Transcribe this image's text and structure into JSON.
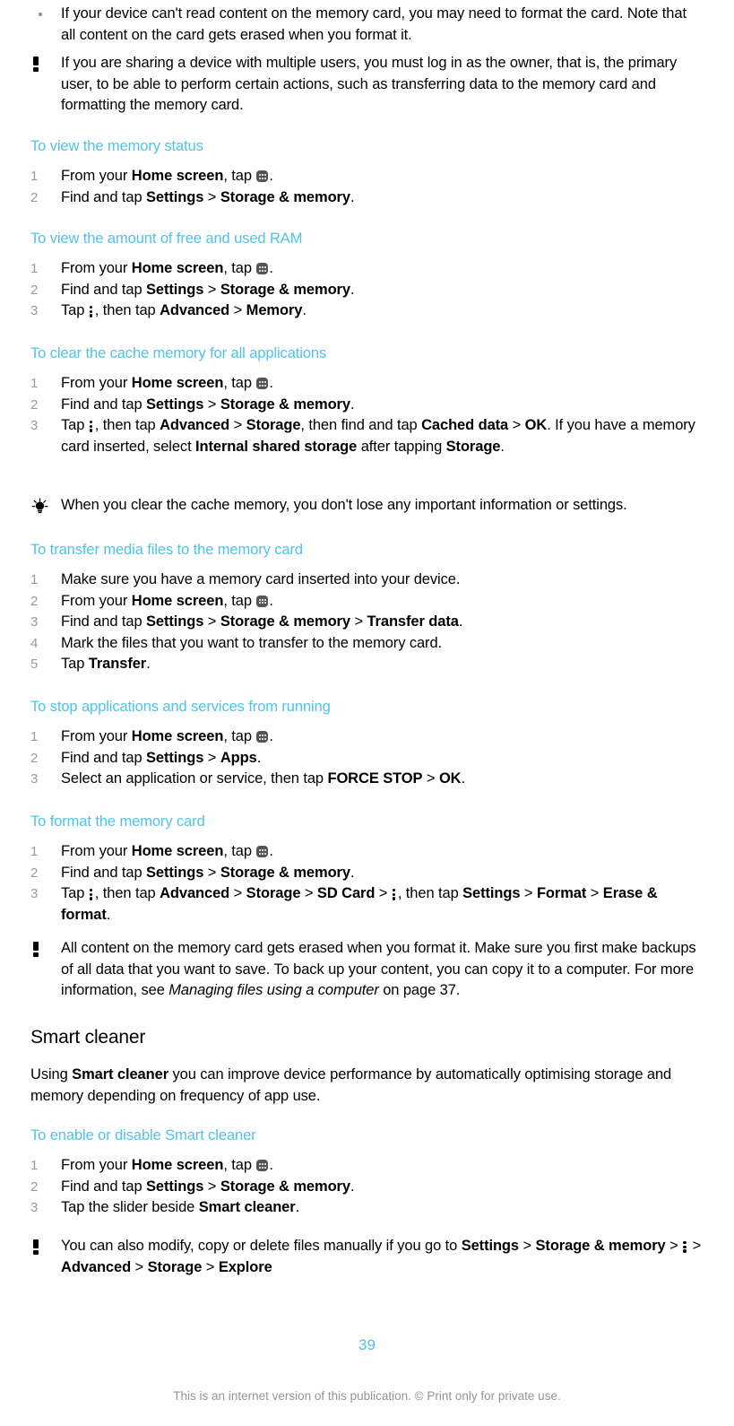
{
  "page": {
    "number": "39",
    "footer": "This is an internet version of this publication. © Print only for private use."
  },
  "icons": {
    "app_drawer": "app-drawer-icon",
    "overflow": "overflow-menu-icon",
    "note": "exclamation-note-icon",
    "tip": "lightbulb-tip-icon",
    "bullet": "bullet-dot-icon"
  },
  "colors": {
    "heading_cyan": "#4ec3ea",
    "list_number_gray": "#9a9a9a",
    "footer_gray": "#949494",
    "body_black": "#000000",
    "icon_dark": "#555555"
  },
  "blocks": {
    "bullet_format_card": {
      "text_1": "If your device can't read content on the memory card, you may need to format the ",
      "text_2": "card. Note that all content on the card gets erased when you format it."
    },
    "note_multiple_users": {
      "text_1": "If you are sharing a device with multiple users, you must log in as the owner, that is, the ",
      "text_2": "primary user, to be able to perform certain actions, such as transferring data to the memory ",
      "text_3": "card and formatting the memory card."
    },
    "task_memory_status": {
      "title": "To view the memory status",
      "steps": [
        {
          "num": "1",
          "parts": [
            {
              "t": "From your ",
              "s": "plain"
            },
            {
              "t": "Home screen",
              "s": "bold"
            },
            {
              "t": ", tap ",
              "s": "plain"
            },
            {
              "t": "",
              "s": "appdrawer"
            },
            {
              "t": ".",
              "s": "plain"
            }
          ]
        },
        {
          "num": "2",
          "parts": [
            {
              "t": "Find and tap ",
              "s": "plain"
            },
            {
              "t": "Settings",
              "s": "bold"
            },
            {
              "t": " > ",
              "s": "plain"
            },
            {
              "t": "Storage & memory",
              "s": "bold"
            },
            {
              "t": ".",
              "s": "plain"
            }
          ]
        }
      ]
    },
    "task_free_used_ram": {
      "title": "To view the amount of free and used RAM",
      "steps": [
        {
          "num": "1",
          "parts": [
            {
              "t": "From your ",
              "s": "plain"
            },
            {
              "t": "Home screen",
              "s": "bold"
            },
            {
              "t": ", tap ",
              "s": "plain"
            },
            {
              "t": "",
              "s": "appdrawer"
            },
            {
              "t": ".",
              "s": "plain"
            }
          ]
        },
        {
          "num": "2",
          "parts": [
            {
              "t": "Find and tap ",
              "s": "plain"
            },
            {
              "t": "Settings",
              "s": "bold"
            },
            {
              "t": " > ",
              "s": "plain"
            },
            {
              "t": "Storage & memory",
              "s": "bold"
            },
            {
              "t": ".",
              "s": "plain"
            }
          ]
        },
        {
          "num": "3",
          "parts": [
            {
              "t": "Tap ",
              "s": "plain"
            },
            {
              "t": "",
              "s": "kebab"
            },
            {
              "t": ", then tap ",
              "s": "plain"
            },
            {
              "t": "Advanced",
              "s": "bold"
            },
            {
              "t": " > ",
              "s": "plain"
            },
            {
              "t": "Memory",
              "s": "bold"
            },
            {
              "t": ".",
              "s": "plain"
            }
          ]
        }
      ]
    },
    "task_clear_cache": {
      "title": "To clear the cache memory for all applications",
      "steps": [
        {
          "num": "1",
          "parts": [
            {
              "t": "From your ",
              "s": "plain"
            },
            {
              "t": "Home screen",
              "s": "bold"
            },
            {
              "t": ", tap ",
              "s": "plain"
            },
            {
              "t": "",
              "s": "appdrawer"
            },
            {
              "t": ".",
              "s": "plain"
            }
          ]
        },
        {
          "num": "2",
          "parts": [
            {
              "t": "Find and tap ",
              "s": "plain"
            },
            {
              "t": "Settings",
              "s": "bold"
            },
            {
              "t": " > ",
              "s": "plain"
            },
            {
              "t": "Storage & memory",
              "s": "bold"
            },
            {
              "t": ".",
              "s": "plain"
            }
          ]
        },
        {
          "num": "3",
          "parts": [
            {
              "t": "Tap ",
              "s": "plain"
            },
            {
              "t": "",
              "s": "kebab"
            },
            {
              "t": ", then tap ",
              "s": "plain"
            },
            {
              "t": "Advanced",
              "s": "bold"
            },
            {
              "t": " > ",
              "s": "plain"
            },
            {
              "t": "Storage",
              "s": "bold"
            },
            {
              "t": ", then find and tap ",
              "s": "plain"
            },
            {
              "t": "Cached data",
              "s": "bold"
            },
            {
              "t": " > ",
              "s": "plain"
            },
            {
              "t": "OK",
              "s": "bold"
            },
            {
              "t": ". If you have a memory card inserted, select ",
              "s": "plain"
            },
            {
              "t": "Internal shared storage",
              "s": "bold"
            },
            {
              "t": " after tapping ",
              "s": "plain"
            },
            {
              "t": "Storage",
              "s": "bold"
            },
            {
              "t": ".",
              "s": "plain"
            }
          ]
        }
      ]
    },
    "tip_clear_cache": {
      "text": "When you clear the cache memory, you don't lose any important information or settings."
    },
    "task_transfer_media": {
      "title": "To transfer media files to the memory card",
      "steps": [
        {
          "num": "1",
          "parts": [
            {
              "t": "Make sure you have a memory card inserted into your device.",
              "s": "plain"
            }
          ]
        },
        {
          "num": "2",
          "parts": [
            {
              "t": "From your ",
              "s": "plain"
            },
            {
              "t": "Home screen",
              "s": "bold"
            },
            {
              "t": ", tap ",
              "s": "plain"
            },
            {
              "t": "",
              "s": "appdrawer"
            },
            {
              "t": ".",
              "s": "plain"
            }
          ]
        },
        {
          "num": "3",
          "parts": [
            {
              "t": "Find and tap ",
              "s": "plain"
            },
            {
              "t": "Settings",
              "s": "bold"
            },
            {
              "t": " > ",
              "s": "plain"
            },
            {
              "t": "Storage & memory",
              "s": "bold"
            },
            {
              "t": " > ",
              "s": "plain"
            },
            {
              "t": "Transfer data",
              "s": "bold"
            },
            {
              "t": ".",
              "s": "plain"
            }
          ]
        },
        {
          "num": "4",
          "parts": [
            {
              "t": "Mark the files that you want to transfer to the memory card.",
              "s": "plain"
            }
          ]
        },
        {
          "num": "5",
          "parts": [
            {
              "t": "Tap ",
              "s": "plain"
            },
            {
              "t": "Transfer",
              "s": "bold"
            },
            {
              "t": ".",
              "s": "plain"
            }
          ]
        }
      ]
    },
    "task_stop_apps": {
      "title": "To stop applications and services from running",
      "steps": [
        {
          "num": "1",
          "parts": [
            {
              "t": "From your ",
              "s": "plain"
            },
            {
              "t": "Home screen",
              "s": "bold"
            },
            {
              "t": ", tap ",
              "s": "plain"
            },
            {
              "t": "",
              "s": "appdrawer"
            },
            {
              "t": ".",
              "s": "plain"
            }
          ]
        },
        {
          "num": "2",
          "parts": [
            {
              "t": "Find and tap ",
              "s": "plain"
            },
            {
              "t": "Settings",
              "s": "bold"
            },
            {
              "t": " > ",
              "s": "plain"
            },
            {
              "t": "Apps",
              "s": "bold"
            },
            {
              "t": ".",
              "s": "plain"
            }
          ]
        },
        {
          "num": "3",
          "parts": [
            {
              "t": "Select an application or service, then tap ",
              "s": "plain"
            },
            {
              "t": "FORCE STOP",
              "s": "bold"
            },
            {
              "t": " > ",
              "s": "plain"
            },
            {
              "t": "OK",
              "s": "bold"
            },
            {
              "t": ".",
              "s": "plain"
            }
          ]
        }
      ]
    },
    "task_format_card": {
      "title": "To format the memory card",
      "steps": [
        {
          "num": "1",
          "parts": [
            {
              "t": "From your ",
              "s": "plain"
            },
            {
              "t": "Home screen",
              "s": "bold"
            },
            {
              "t": ", tap ",
              "s": "plain"
            },
            {
              "t": "",
              "s": "appdrawer"
            },
            {
              "t": ".",
              "s": "plain"
            }
          ]
        },
        {
          "num": "2",
          "parts": [
            {
              "t": "Find and tap ",
              "s": "plain"
            },
            {
              "t": "Settings",
              "s": "bold"
            },
            {
              "t": " > ",
              "s": "plain"
            },
            {
              "t": "Storage & memory",
              "s": "bold"
            },
            {
              "t": ".",
              "s": "plain"
            }
          ]
        },
        {
          "num": "3",
          "parts": [
            {
              "t": "Tap ",
              "s": "plain"
            },
            {
              "t": "",
              "s": "kebab"
            },
            {
              "t": ", then tap ",
              "s": "plain"
            },
            {
              "t": "Advanced",
              "s": "bold"
            },
            {
              "t": " > ",
              "s": "plain"
            },
            {
              "t": "Storage",
              "s": "bold"
            },
            {
              "t": " > ",
              "s": "plain"
            },
            {
              "t": "SD Card",
              "s": "bold"
            },
            {
              "t": " > ",
              "s": "plain"
            },
            {
              "t": "",
              "s": "kebab"
            },
            {
              "t": ", then tap ",
              "s": "plain"
            },
            {
              "t": "Settings",
              "s": "bold"
            },
            {
              "t": " > ",
              "s": "plain"
            },
            {
              "t": "Format",
              "s": "bold"
            },
            {
              "t": " > ",
              "s": "plain"
            },
            {
              "t": "Erase & format",
              "s": "bold"
            },
            {
              "t": ".",
              "s": "plain"
            }
          ]
        }
      ]
    },
    "note_format_erases": {
      "text_before": "All content on the memory card gets erased when you format it. Make sure you first make backups of all data that you want to save. To back up your content, you can copy it to a computer. For more information, see ",
      "italic_ref": "Managing files using a computer",
      "text_after": " on page 37."
    },
    "section_smart_cleaner": {
      "title": "Smart cleaner",
      "body_parts": [
        {
          "t": "Using ",
          "s": "plain"
        },
        {
          "t": "Smart cleaner",
          "s": "bold"
        },
        {
          "t": " you can improve device performance by automatically optimising storage and memory depending on frequency of app use.",
          "s": "plain"
        }
      ]
    },
    "task_smart_cleaner_toggle": {
      "title": "To enable or disable Smart cleaner",
      "steps": [
        {
          "num": "1",
          "parts": [
            {
              "t": "From your ",
              "s": "plain"
            },
            {
              "t": "Home screen",
              "s": "bold"
            },
            {
              "t": ", tap ",
              "s": "plain"
            },
            {
              "t": "",
              "s": "appdrawer"
            },
            {
              "t": ".",
              "s": "plain"
            }
          ]
        },
        {
          "num": "2",
          "parts": [
            {
              "t": "Find and tap ",
              "s": "plain"
            },
            {
              "t": "Settings",
              "s": "bold"
            },
            {
              "t": " > ",
              "s": "plain"
            },
            {
              "t": "Storage & memory",
              "s": "bold"
            },
            {
              "t": ".",
              "s": "plain"
            }
          ]
        },
        {
          "num": "3",
          "parts": [
            {
              "t": "Tap the slider beside ",
              "s": "plain"
            },
            {
              "t": "Smart cleaner",
              "s": "bold"
            },
            {
              "t": ".",
              "s": "plain"
            }
          ]
        }
      ]
    },
    "note_manual_files": {
      "parts": [
        {
          "t": "You can also modify, copy or delete files manually if you go to ",
          "s": "plain"
        },
        {
          "t": "Settings",
          "s": "bold"
        },
        {
          "t": " > ",
          "s": "plain"
        },
        {
          "t": "Storage & memory",
          "s": "bold"
        },
        {
          "t": " > ",
          "s": "plain"
        },
        {
          "t": "",
          "s": "kebab"
        },
        {
          "t": " > ",
          "s": "plain"
        },
        {
          "t": "Advanced",
          "s": "bold"
        },
        {
          "t": " > ",
          "s": "plain"
        },
        {
          "t": "Storage",
          "s": "bold"
        },
        {
          "t": " > ",
          "s": "plain"
        },
        {
          "t": "Explore",
          "s": "bold"
        }
      ]
    }
  }
}
